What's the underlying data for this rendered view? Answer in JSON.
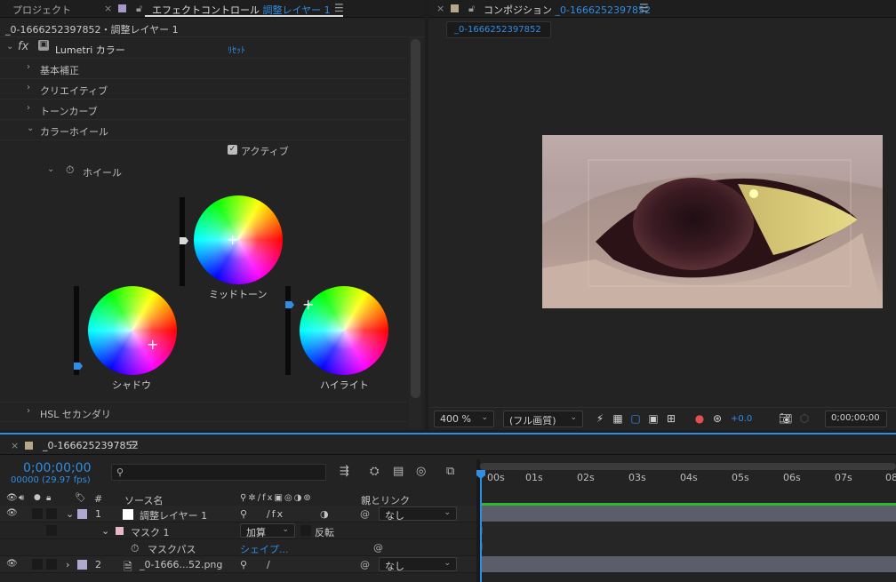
{
  "effect_panel": {
    "tab_project": "プロジェクト",
    "tab_effect_label": "エフェクトコントロール",
    "tab_effect_target": "調整レイヤー 1",
    "subheader": "_0-1666252397852・調整レイヤー 1",
    "fx_label": "fx",
    "effect_name": "Lumetri カラー",
    "reset_label": "ﾘｾｯﾄ",
    "sections": [
      "基本補正",
      "クリエイティブ",
      "トーンカーブ",
      "カラーホイール"
    ],
    "active_label": "アクティブ",
    "wheels_label": "ホイール",
    "wheel_midtone": "ミッドトーン",
    "wheel_shadow": "シャドウ",
    "wheel_highlight": "ハイライト",
    "hsl_label": "HSL セカンダリ"
  },
  "comp_panel": {
    "tab_label": "コンポジション",
    "comp_name": "_0-1666252397852",
    "chip_name": "_0-1666252397852",
    "zoom": "400 %",
    "resolution": "(フル画質)",
    "exposure": "+0.0",
    "timecode": "0;00;00;00"
  },
  "timeline": {
    "comp_name": "_0-1666252397852",
    "current_time": "0;00;00;00",
    "frame_info": "00000 (29.97 fps)",
    "search_placeholder": "",
    "col_hash": "#",
    "col_source": "ソース名",
    "col_parent": "親とリンク",
    "ruler_ticks": [
      "00s",
      "01s",
      "02s",
      "03s",
      "04s",
      "05s",
      "06s",
      "07s",
      "08"
    ],
    "layers": [
      {
        "index": "1",
        "name": "調整レイヤー 1",
        "parent": "なし"
      },
      {
        "index": "2",
        "name": "_0-1666...52.png",
        "parent": "なし"
      }
    ],
    "mask_name": "マスク 1",
    "mask_mode": "加算",
    "mask_invert": "反転",
    "mask_path_label": "マスクパス",
    "mask_path_value": "シェイプ..."
  },
  "colors": {
    "accent_blue": "#2f8de4",
    "adjustment_layer_label": "#b0a8d0",
    "mask_label": "#e8b8c8",
    "green_bar": "#2fb52f"
  }
}
